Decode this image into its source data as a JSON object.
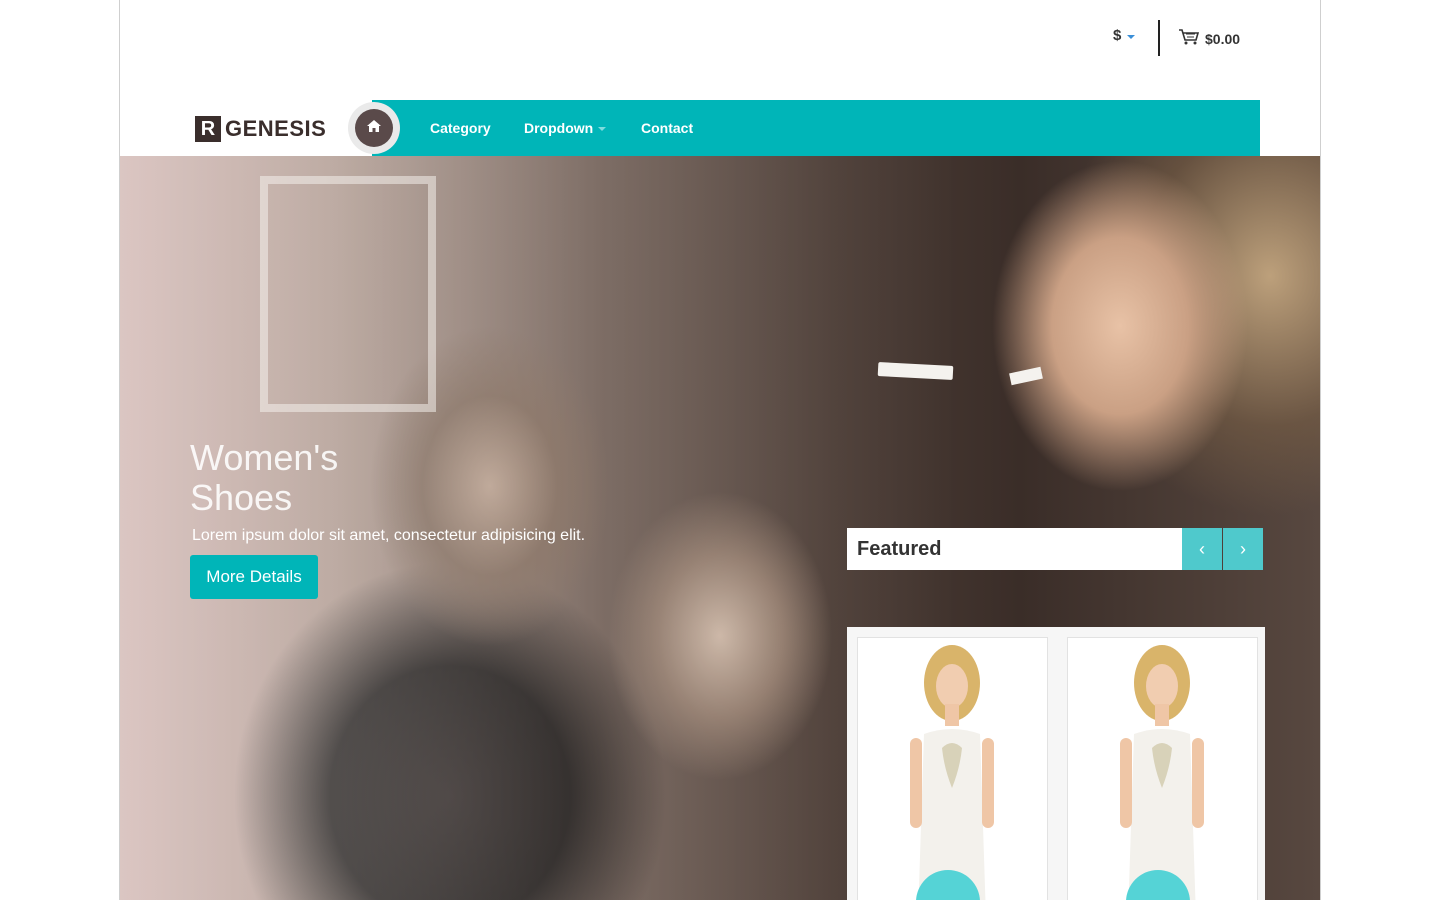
{
  "header": {
    "currency_symbol": "$",
    "cart_total": "$0.00",
    "logo_mark": "R",
    "logo_text": "GENESIS"
  },
  "nav": {
    "items": [
      {
        "label": "Category"
      },
      {
        "label": "Dropdown"
      },
      {
        "label": "Contact"
      }
    ]
  },
  "hero": {
    "title": "Women's Shoes",
    "subtitle": "Lorem ipsum dolor sit amet, consectetur adipisicing elit.",
    "button_label": "More Details"
  },
  "featured": {
    "title": "Featured",
    "prev_glyph": "‹",
    "next_glyph": "›"
  },
  "colors": {
    "accent": "#00b5b8",
    "accent_light": "#4fc9cc",
    "logo_dark": "#3a2e2c"
  },
  "icons": [
    "chevron-down-icon",
    "cart-icon",
    "home-icon",
    "chevron-left-icon",
    "chevron-right-icon"
  ]
}
